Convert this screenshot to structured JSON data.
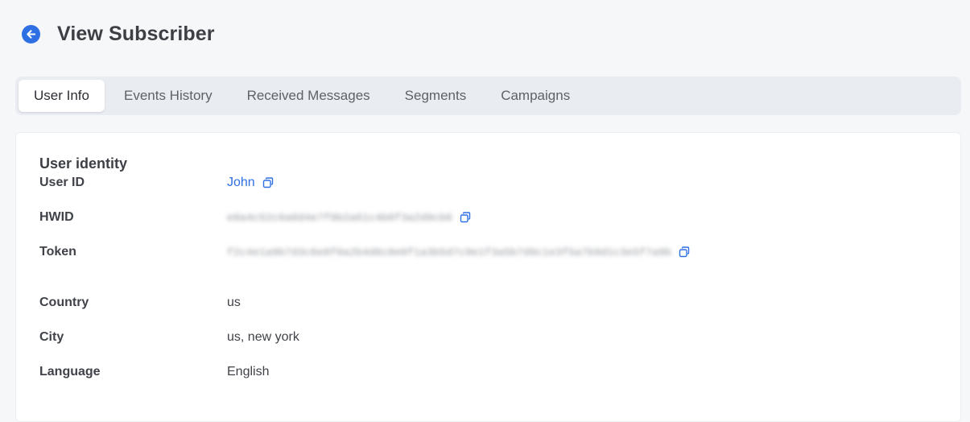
{
  "header": {
    "title": "View Subscriber",
    "back_icon": "arrow-left-circle-icon",
    "accent": "#2f6fe4"
  },
  "tabs": [
    {
      "label": "User Info",
      "active": true
    },
    {
      "label": "Events History",
      "active": false
    },
    {
      "label": "Received Messages",
      "active": false
    },
    {
      "label": "Segments",
      "active": false
    },
    {
      "label": "Campaigns",
      "active": false
    }
  ],
  "user_identity": {
    "section_title": "User identity",
    "user_id": {
      "label": "User ID",
      "value": "John",
      "icon": "copy-icon"
    },
    "hwid": {
      "label": "HWID",
      "value": "e8a4c52c6a0d4e7f9b2a61c4b8f3a2d9cb6",
      "icon": "copy-icon"
    },
    "token": {
      "label": "Token",
      "value": "f2c4e1a9b7d3c6e8f0a2b4d6c8e0f1a3b5d7c9e1f3a5b7d9c1e3f5a7b9d1c3e5f7a9b",
      "icon": "copy-icon"
    }
  },
  "location": {
    "country": {
      "label": "Country",
      "value": "us"
    },
    "city": {
      "label": "City",
      "value": "us, new york"
    },
    "language": {
      "label": "Language",
      "value": "English"
    }
  }
}
